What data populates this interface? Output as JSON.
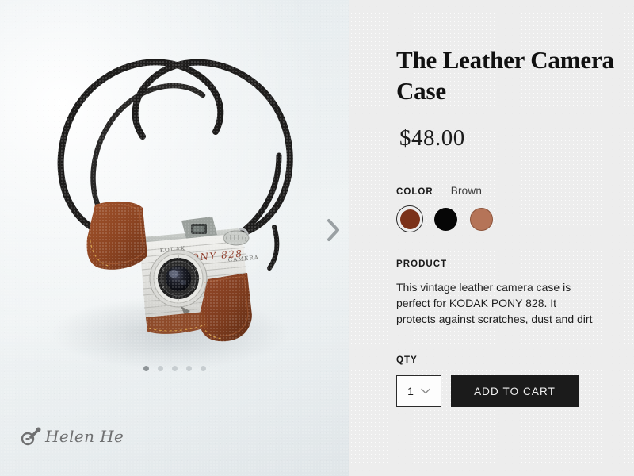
{
  "gallery": {
    "next_arrow_icon": "chevron-right-icon",
    "slide_count": 5,
    "active_slide": 1,
    "watermark_text": "Helen He",
    "watermark_icon": "camera-icon",
    "photo_alt": "Vintage Kodak Pony 828 camera in brown leather case with black neck strap"
  },
  "product": {
    "title": "The Leather Camera Case",
    "price": "$48.00",
    "color_label": "COLOR",
    "color_value": "Brown",
    "swatches": [
      {
        "name": "brown",
        "hex": "#7B3119",
        "selected": true
      },
      {
        "name": "black",
        "hex": "#060606",
        "selected": false
      },
      {
        "name": "tan",
        "hex": "#B57458",
        "selected": false
      }
    ],
    "product_label": "PRODUCT",
    "description": "This vintage leather camera case is perfect for KODAK PONY 828. It protects against scratches, dust and dirt",
    "qty_label": "QTY",
    "qty_value": "1",
    "qty_chevron_icon": "chevron-down-icon",
    "add_to_cart_label": "ADD TO CART"
  },
  "colors": {
    "panel_bg": "#ededed",
    "button_bg": "#1b1b1b",
    "accent": "#7B3119",
    "gallery_bg": "#e9eef0"
  }
}
